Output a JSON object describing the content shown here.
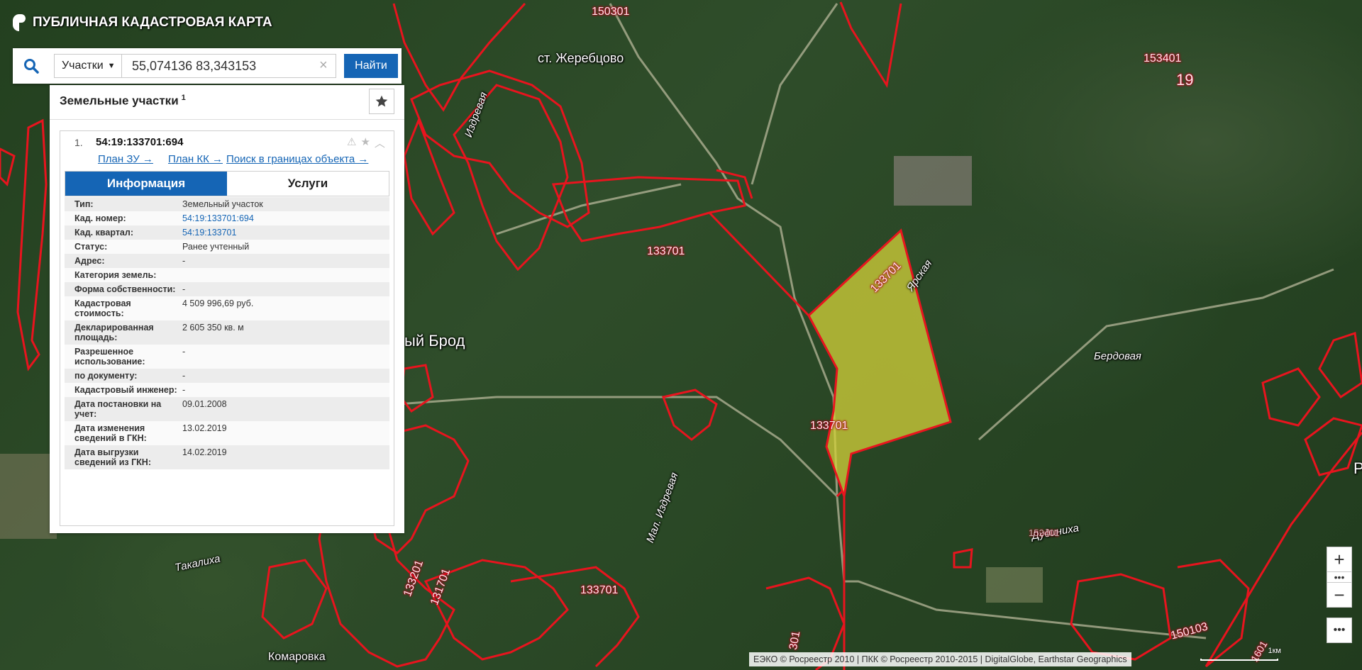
{
  "app": {
    "title": "ПУБЛИЧНАЯ КАДАСТРОВАЯ КАРТА"
  },
  "search": {
    "type_label": "Участки",
    "query": "55,074136 83,343153",
    "button_label": "Найти"
  },
  "results": {
    "title": "Земельные участки",
    "count": "1",
    "item": {
      "index": "1.",
      "number": "54:19:133701:694",
      "links": {
        "plan_zu": "План ЗУ →",
        "plan_kk": "План КК →",
        "search_bounds": "Поиск в границах объекта →"
      },
      "tabs": {
        "info": "Информация",
        "services": "Услуги"
      },
      "fields": [
        {
          "key": "Тип:",
          "value": "Земельный участок"
        },
        {
          "key": "Кад. номер:",
          "value": "54:19:133701:694"
        },
        {
          "key": "Кад. квартал:",
          "value": "54:19:133701"
        },
        {
          "key": "Статус:",
          "value": "Ранее учтенный"
        },
        {
          "key": "Адрес:",
          "value": "-"
        },
        {
          "key": "Категория земель:",
          "value": ""
        },
        {
          "key": "Форма собственности:",
          "value": "-"
        },
        {
          "key": "Кадастровая стоимость:",
          "value": "4 509 996,69 руб."
        },
        {
          "key": "Декларированная площадь:",
          "value": "2 605 350 кв. м"
        },
        {
          "key": "Разрешенное использование:",
          "value": "-"
        },
        {
          "key": "по документу:",
          "value": "-"
        },
        {
          "key": "Кадастровый инженер:",
          "value": "-"
        },
        {
          "key": "Дата постановки на учет:",
          "value": "09.01.2008"
        },
        {
          "key": "Дата изменения сведений в ГКН:",
          "value": "13.02.2019"
        },
        {
          "key": "Дата выгрузки сведений из ГКН:",
          "value": "14.02.2019"
        }
      ]
    }
  },
  "map": {
    "labels": {
      "l150301": "150301",
      "zherebtsovo": "ст. Жеребцово",
      "l153401": "153401",
      "l19": "19",
      "izdrevaya": "Издревая",
      "l133701_a": "133701",
      "l133701_b": "133701",
      "l133701_c": "133701",
      "l133701_d": "133701",
      "yarskaya": "Ярская",
      "brod": "ый Брод",
      "berdovaya": "Бердовая",
      "mal_izdrevaya": "Мал. Издревая",
      "dudinikha": "Дудиниха",
      "l152401": "152401",
      "takalikha": "Такалиха",
      "l133201": "133201",
      "l131701": "131701",
      "l150103": "150103",
      "komarovka": "Комаровка",
      "l301": "301",
      "l1601": "1601",
      "edge_r": "Р"
    },
    "highlight_color": "#d4d23a",
    "boundary_color": "#e8141e"
  },
  "controls": {
    "zoom_in": "+",
    "zoom_out": "−",
    "dots": "•••",
    "more": "•••"
  },
  "attribution": "ЕЭКО © Росреестр 2010 | ПКК © Росреестр 2010-2015 | DigitalGlobe, Earthstar Geographics",
  "scale": "1км"
}
